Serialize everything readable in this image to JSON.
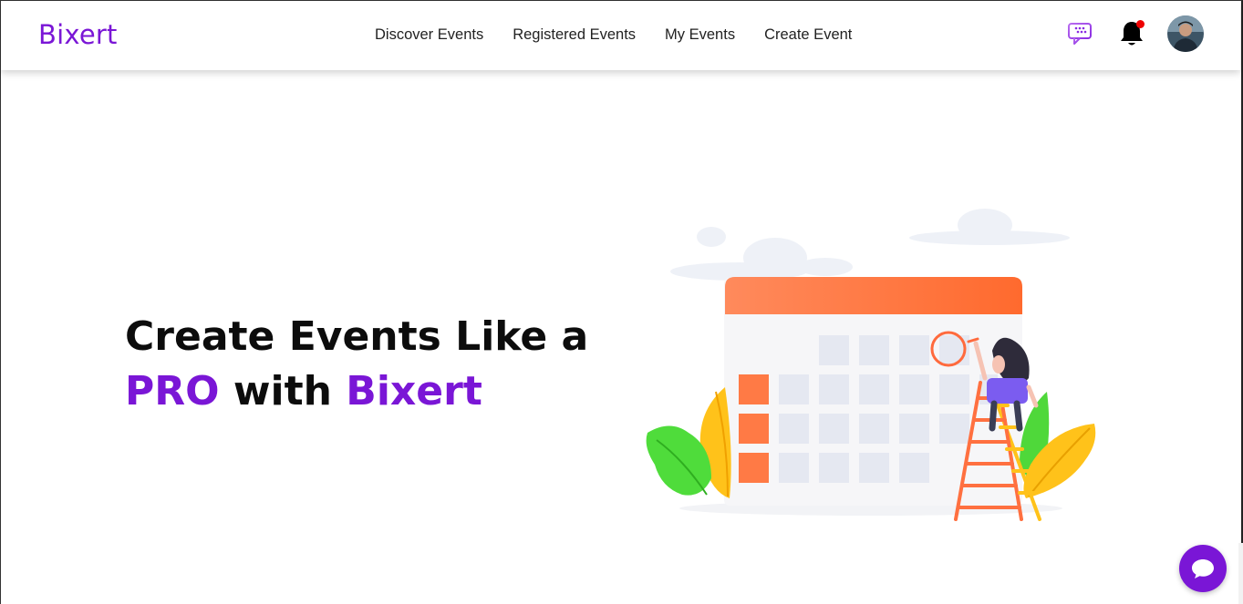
{
  "brand": {
    "name": "Bixert"
  },
  "nav": {
    "links": [
      {
        "label": "Discover Events"
      },
      {
        "label": "Registered Events"
      },
      {
        "label": "My Events"
      },
      {
        "label": "Create Event"
      }
    ]
  },
  "header_icons": {
    "messages": "chat-bubble-icon",
    "notifications": "bell-icon",
    "notification_indicator": true
  },
  "hero": {
    "line1": "Create Events Like a",
    "line2_part1": "PRO",
    "line2_part2": " with ",
    "line2_part3": "Bixert"
  },
  "colors": {
    "accent": "#7a16d6",
    "calendar_header": "#ff6a3d",
    "notification_dot": "#ee0000"
  },
  "fab": {
    "icon": "chat-icon"
  }
}
